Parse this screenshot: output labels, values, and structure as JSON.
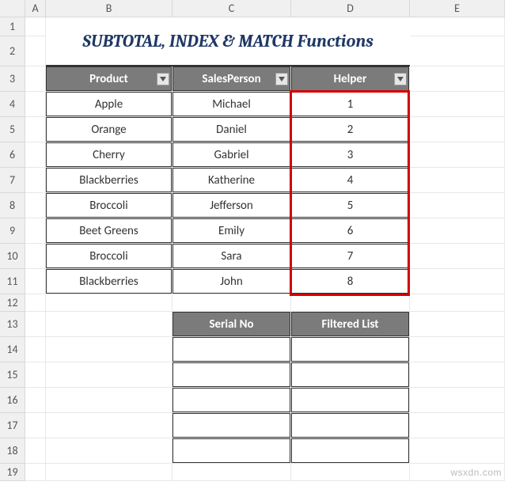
{
  "columns": [
    "A",
    "B",
    "C",
    "D",
    "E"
  ],
  "rows": [
    "1",
    "2",
    "3",
    "4",
    "5",
    "6",
    "7",
    "8",
    "9",
    "10",
    "11",
    "12",
    "13",
    "14",
    "15",
    "16",
    "17",
    "18",
    "19"
  ],
  "title": "SUBTOTAL, INDEX & MATCH Functions",
  "table1": {
    "headers": [
      "Product",
      "SalesPerson",
      "Helper"
    ],
    "rows": [
      {
        "product": "Apple",
        "sales": "Michael",
        "helper": "1"
      },
      {
        "product": "Orange",
        "sales": "Daniel",
        "helper": "2"
      },
      {
        "product": "Cherry",
        "sales": "Gabriel",
        "helper": "3"
      },
      {
        "product": "Blackberries",
        "sales": "Katherine",
        "helper": "4"
      },
      {
        "product": "Broccoli",
        "sales": "Jefferson",
        "helper": "5"
      },
      {
        "product": "Beet Greens",
        "sales": "Emily",
        "helper": "6"
      },
      {
        "product": "Broccoli",
        "sales": "Sara",
        "helper": "7"
      },
      {
        "product": "Blackberries",
        "sales": "John",
        "helper": "8"
      }
    ]
  },
  "table2": {
    "headers": [
      "Serial No",
      "Filtered List"
    ],
    "blankRows": 5
  },
  "watermark": "wsxdn.com"
}
